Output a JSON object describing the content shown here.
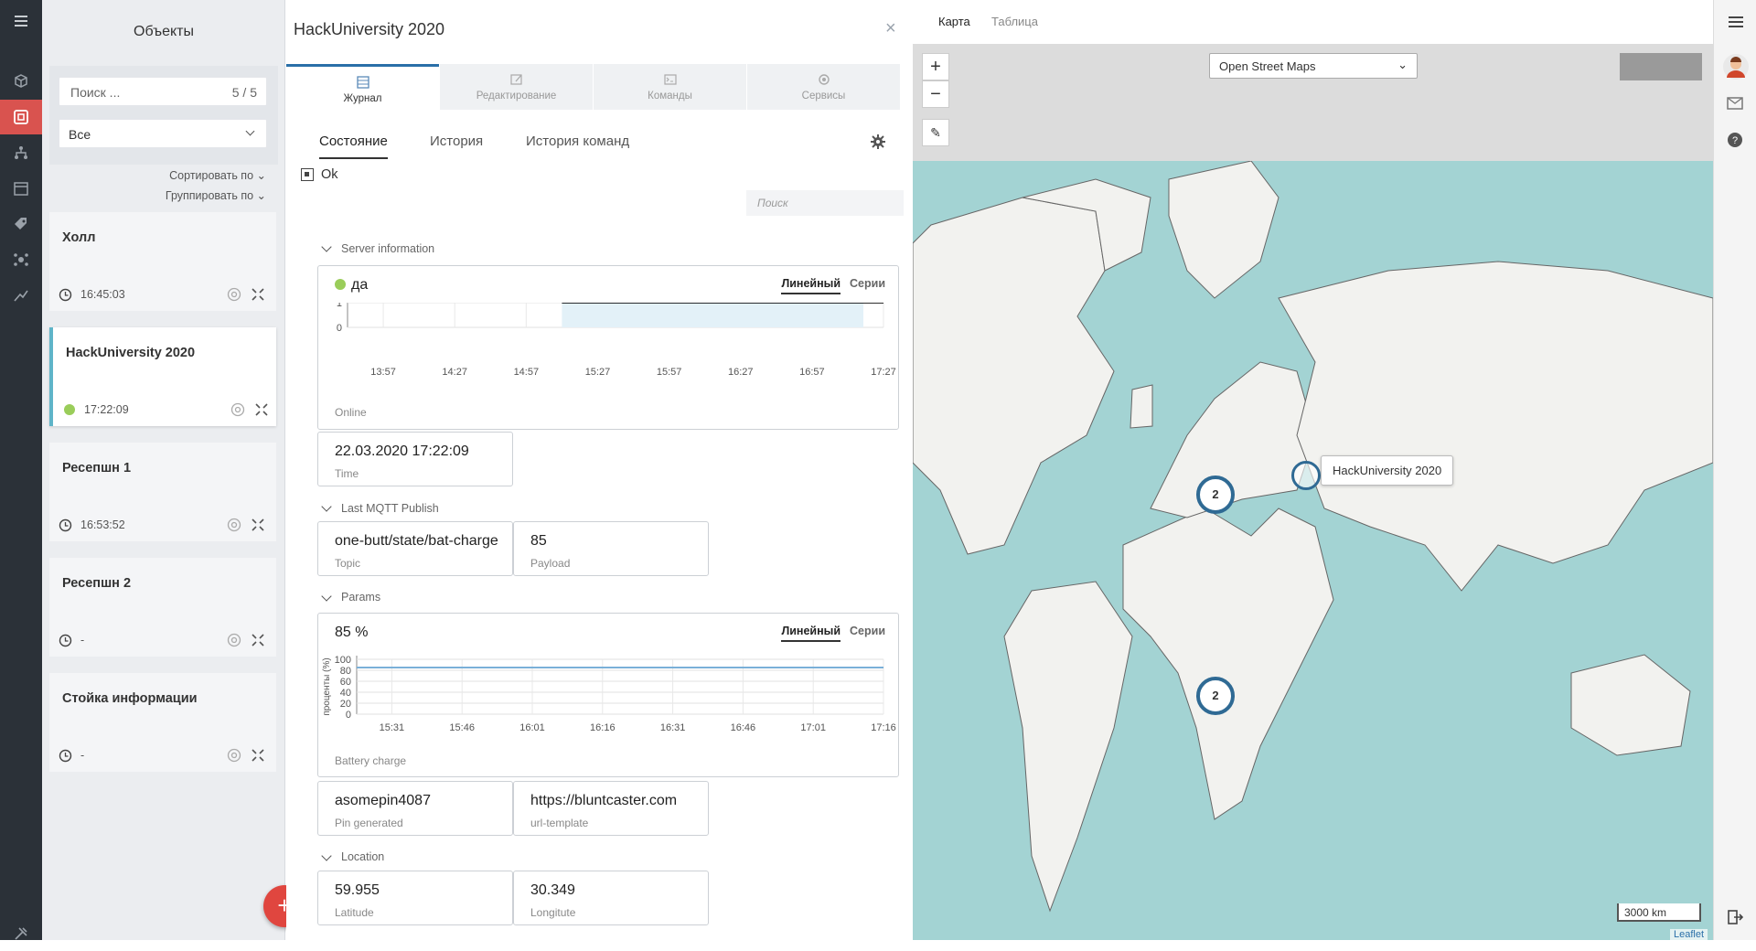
{
  "sidebar_icons": [
    "menu-icon",
    "cube-icon",
    "objects-icon",
    "hierarchy-icon",
    "calendar-icon",
    "tag-icon",
    "network-icon",
    "analytics-icon",
    "tools-icon"
  ],
  "objects": {
    "title": "Объекты",
    "search_placeholder": "Поиск ...",
    "search_count": "5 / 5",
    "filter_value": "Все",
    "sort_label": "Сортировать по",
    "group_label": "Группировать по",
    "cards": [
      {
        "title": "Холл",
        "time": "16:45:03",
        "status": "clock"
      },
      {
        "title": "HackUniversity 2020",
        "time": "17:22:09",
        "status": "online"
      },
      {
        "title": "Ресепшн 1",
        "time": "16:53:52",
        "status": "clock"
      },
      {
        "title": "Ресепшн 2",
        "time": "-",
        "status": "clock"
      },
      {
        "title": "Стойка информации",
        "time": "-",
        "status": "clock"
      }
    ],
    "add_label": "+"
  },
  "detail": {
    "title": "HackUniversity 2020",
    "close": "×",
    "main_tabs": [
      {
        "label": "Журнал",
        "active": true
      },
      {
        "label": "Редактирование"
      },
      {
        "label": "Команды"
      },
      {
        "label": "Сервисы"
      }
    ],
    "sub_tabs": [
      {
        "label": "Состояние",
        "active": true
      },
      {
        "label": "История"
      },
      {
        "label": "История команд"
      }
    ],
    "status": "Ok",
    "search_placeholder": "Поиск",
    "server_section": "Server information",
    "online_chart": {
      "value": "да",
      "mode_active": "Линейный",
      "mode_other": "Серии",
      "caption": "Online"
    },
    "time_value": "22.03.2020 17:22:09",
    "time_label": "Time",
    "mqtt_section": "Last MQTT Publish",
    "topic_value": "one-butt/state/bat-charge",
    "topic_label": "Topic",
    "payload_value": "85",
    "payload_label": "Payload",
    "params_section": "Params",
    "battery_chart": {
      "value": "85 %",
      "mode_active": "Линейный",
      "mode_other": "Серии",
      "caption": "Battery charge"
    },
    "pin_value": "asomepin4087",
    "pin_label": "Pin generated",
    "url_value": "https://bluntcaster.com",
    "url_label": "url-template",
    "location_section": "Location",
    "lat_value": "59.955",
    "lat_label": "Latitude",
    "lon_value": "30.349",
    "lon_label": "Longitute"
  },
  "chart_data": [
    {
      "type": "line",
      "title": "Online",
      "x": [
        "13:57",
        "14:27",
        "14:57",
        "15:27",
        "15:57",
        "16:27",
        "16:57",
        "17:27"
      ],
      "ylim": [
        0,
        1
      ],
      "yticks": [
        "1",
        "0"
      ],
      "series": [
        {
          "values": [
            null,
            null,
            null,
            1,
            1,
            1,
            1,
            1
          ]
        }
      ]
    },
    {
      "type": "line",
      "title": "Battery charge",
      "ylabel": "проценты (%)",
      "x": [
        "15:31",
        "15:46",
        "16:01",
        "16:16",
        "16:31",
        "16:46",
        "17:01",
        "17:16"
      ],
      "ylim": [
        0,
        100
      ],
      "yticks": [
        "100",
        "80",
        "60",
        "40",
        "20",
        "0"
      ],
      "series": [
        {
          "values": [
            85,
            85,
            85,
            85,
            85,
            85,
            85,
            85
          ]
        }
      ]
    }
  ],
  "map": {
    "tabs": [
      "Карта",
      "Таблица"
    ],
    "active_tab": "Карта",
    "layer": "Open Street Maps",
    "zoom_in": "+",
    "zoom_out": "−",
    "clusters": [
      "2",
      "2"
    ],
    "marker_label": "HackUniversity 2020",
    "scale": "3000 km",
    "attribution": "Leaflet"
  },
  "colors": {
    "accent": "#2a6fa8",
    "rail": "#2b3138",
    "active_rail": "#d9534f",
    "online": "#9acd5a",
    "sea": "#a3d3d3"
  }
}
